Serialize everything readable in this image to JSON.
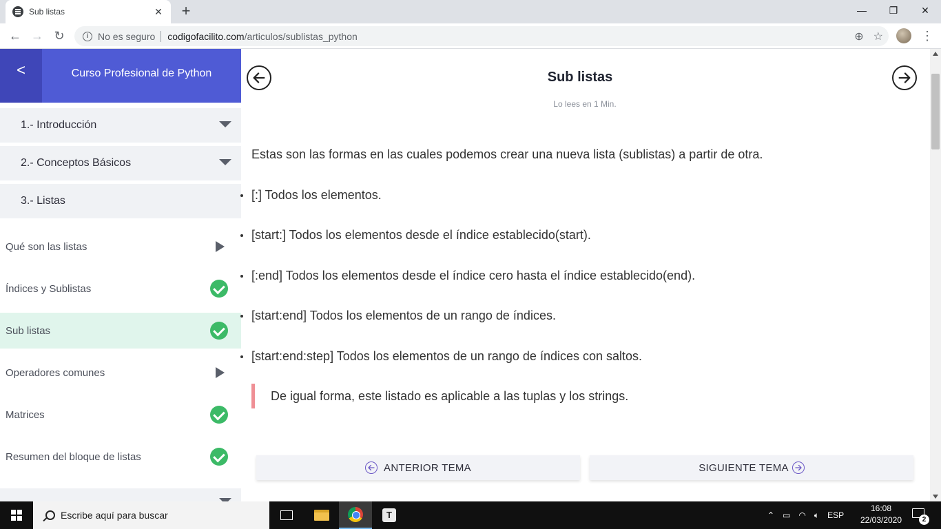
{
  "browser": {
    "tab_title": "Sub listas",
    "tab_close": "✕",
    "new_tab": "+",
    "security_text": "No es seguro",
    "url_host": "codigofacilito.com",
    "url_path": "/articulos/sublistas_python",
    "window_controls": [
      "—",
      "❐",
      "✕"
    ]
  },
  "sidebar": {
    "title": "Curso Profesional de Python",
    "back_label": "<",
    "sections": [
      {
        "label": "1.- Introducción"
      },
      {
        "label": "2.- Conceptos Básicos"
      },
      {
        "label": "3.- Listas"
      }
    ],
    "lessons": [
      {
        "label": "Qué son las listas",
        "status": "play"
      },
      {
        "label": "Índices y Sublistas",
        "status": "done"
      },
      {
        "label": "Sub listas",
        "status": "done",
        "active": true
      },
      {
        "label": "Operadores comunes",
        "status": "play"
      },
      {
        "label": "Matrices",
        "status": "done"
      },
      {
        "label": "Resumen del bloque de listas",
        "status": "done"
      }
    ]
  },
  "article": {
    "title": "Sub listas",
    "read_time": "Lo lees en 1 Min.",
    "intro": "Estas son las formas en las cuales podemos crear una nueva lista (sublistas) a partir de otra.",
    "items": [
      "[:] Todos los elementos.",
      "[start:] Todos los elementos desde el índice establecido(start).",
      "[:end] Todos los elementos desde el índice cero hasta el índice establecido(end).",
      "[start:end] Todos los elementos de un rango de índices.",
      "[start:end:step] Todos los elementos de un rango de índices con saltos."
    ],
    "quote": "De igual forma, este listado es aplicable a las tuplas y los strings.",
    "prev_label": "ANTERIOR TEMA",
    "next_label": "SIGUIENTE TEMA"
  },
  "taskbar": {
    "search_placeholder": "Escribe aquí para buscar",
    "language": "ESP",
    "time": "16:08",
    "date": "22/03/2020",
    "notifications": "2",
    "typora_letter": "T"
  },
  "colors": {
    "sidebar_header": "#4f5bd5",
    "sidebar_back": "#3f46b8",
    "active_lesson": "#e0f5ec",
    "check": "#3cba67",
    "quote_border": "#ef8f95",
    "arrow_accent": "#6b58c6"
  }
}
